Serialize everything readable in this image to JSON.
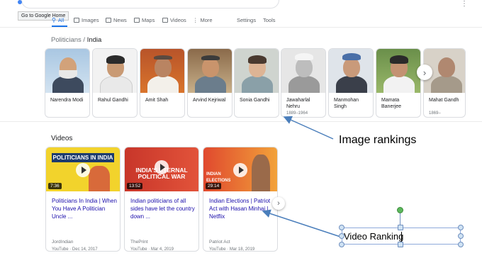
{
  "tooltip": "Go to Google Home",
  "tabs": [
    {
      "label": "All",
      "icon": "search-icon",
      "active": true
    },
    {
      "label": "Images",
      "icon": "image-icon"
    },
    {
      "label": "News",
      "icon": "news-icon"
    },
    {
      "label": "Maps",
      "icon": "map-icon"
    },
    {
      "label": "Videos",
      "icon": "video-icon"
    },
    {
      "label": "More",
      "icon": "more-dots-icon"
    }
  ],
  "settings_label": "Settings",
  "tools_label": "Tools",
  "politicians": {
    "breadcrumb_parent": "Politicians",
    "breadcrumb_sep": " / ",
    "breadcrumb_current": "India",
    "cards": [
      {
        "name": "Narendra Modi",
        "years": ""
      },
      {
        "name": "Rahul Gandhi",
        "years": ""
      },
      {
        "name": "Amit Shah",
        "years": ""
      },
      {
        "name": "Arvind Kejriwal",
        "years": ""
      },
      {
        "name": "Sonia Gandhi",
        "years": ""
      },
      {
        "name": "Jawaharlal Nehru",
        "years": "1889–1964"
      },
      {
        "name": "Manmohan Singh",
        "years": ""
      },
      {
        "name": "Mamata Banerjee",
        "years": ""
      },
      {
        "name": "Mahat Gandh",
        "years": "1869–"
      }
    ],
    "next_glyph": "›"
  },
  "videos": {
    "title": "Videos",
    "items": [
      {
        "thumb_text": "POLITICIANS IN INDIA",
        "duration": "7:36",
        "title": "Politicians In India | When You Have A Politician Uncle ...",
        "source": "JordIndian",
        "meta": "YouTube · Dec 14, 2017"
      },
      {
        "thumb_text": "INDIA'S ETERNAL POLITICAL WAR",
        "duration": "13:52",
        "title": "Indian politicians of all sides have let the country down ...",
        "source": "ThePrint",
        "meta": "YouTube · Mar 4, 2019"
      },
      {
        "thumb_text": "INDIAN ELECTIONS",
        "duration": "29:14",
        "title": "Indian Elections | Patriot Act with Hasan Minhaj | Netflix",
        "source": "Patriot Act",
        "meta": "YouTube · Mar 18, 2019"
      }
    ],
    "next_glyph": "›"
  },
  "annotations": {
    "image_rankings": "Image rankings",
    "video_ranking": "Video Ranking"
  },
  "colors": {
    "accent": "#1a73e8",
    "link": "#1a0dab",
    "arrow": "#4a7ebb"
  }
}
